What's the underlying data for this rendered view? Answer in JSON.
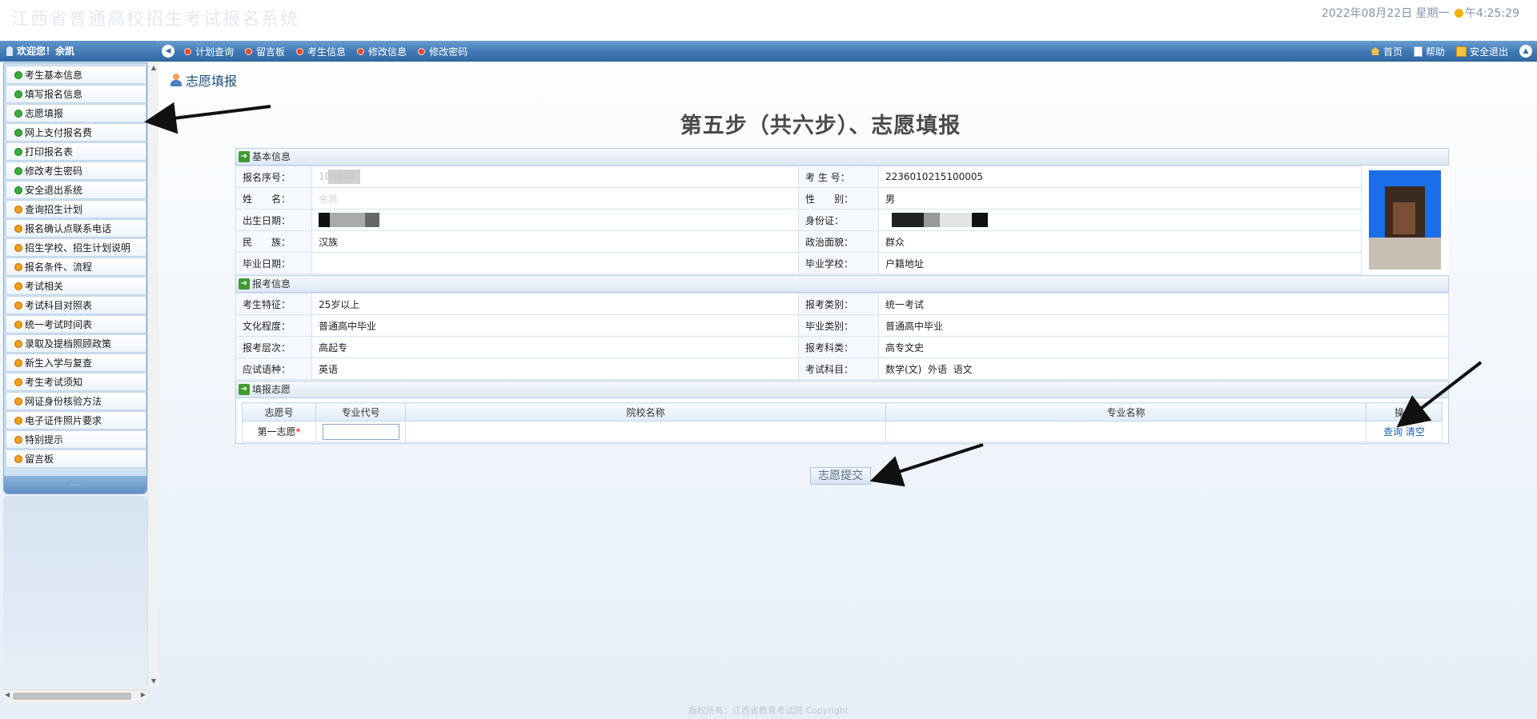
{
  "banner": {
    "title": "江西省普通高校招生考试报名系统",
    "datetime_prefix": "2022年08月22日 星期一",
    "time": "午4:25:29"
  },
  "navbar": {
    "welcome": "欢迎您！余凯",
    "items": [
      "计划查询",
      "留言板",
      "考生信息",
      "修改信息",
      "修改密码"
    ],
    "right": {
      "home": "首页",
      "help": "帮助",
      "logout": "安全退出"
    }
  },
  "sidebar": {
    "items": [
      {
        "label": "考生基本信息",
        "icon": "green"
      },
      {
        "label": "填写报名信息",
        "icon": "green"
      },
      {
        "label": "志愿填报",
        "icon": "green"
      },
      {
        "label": "网上支付报名费",
        "icon": "green"
      },
      {
        "label": "打印报名表",
        "icon": "green"
      },
      {
        "label": "修改考生密码",
        "icon": "green"
      },
      {
        "label": "安全退出系统",
        "icon": "green"
      },
      {
        "label": "查询招生计划",
        "icon": "orange"
      },
      {
        "label": "报名确认点联系电话",
        "icon": "orange"
      },
      {
        "label": "招生学校、招生计划说明",
        "icon": "orange"
      },
      {
        "label": "报名条件、流程",
        "icon": "orange"
      },
      {
        "label": "考试相关",
        "icon": "orange"
      },
      {
        "label": "考试科目对照表",
        "icon": "orange"
      },
      {
        "label": "统一考试时间表",
        "icon": "orange"
      },
      {
        "label": "录取及提档照顾政策",
        "icon": "orange"
      },
      {
        "label": "新生入学与复查",
        "icon": "orange"
      },
      {
        "label": "考生考试须知",
        "icon": "orange"
      },
      {
        "label": "网证身份核验方法",
        "icon": "orange"
      },
      {
        "label": "电子证件照片要求",
        "icon": "orange"
      },
      {
        "label": "特别提示",
        "icon": "orange"
      },
      {
        "label": "留言板",
        "icon": "orange"
      }
    ],
    "footer": "....."
  },
  "main": {
    "heading": "志愿填报",
    "step_title": "第五步（共六步）、志愿填报",
    "basic": {
      "title": "基本信息",
      "rows": [
        {
          "l1": "报名序号：",
          "v1": "100000",
          "l2": "考 生 号：",
          "v2": "2236010215100005"
        },
        {
          "l1": "姓　　名：",
          "v1": "余凯",
          "l2": "性　　别：",
          "v2": "男"
        },
        {
          "l1": "出生日期：",
          "v1": "",
          "l2": "身份证：",
          "v2": ""
        },
        {
          "l1": "民　　族：",
          "v1": "汉族",
          "l2": "政治面貌：",
          "v2": "群众"
        },
        {
          "l1": "毕业日期：",
          "v1": "",
          "l2": "毕业学校：",
          "v2": "户籍地址"
        }
      ]
    },
    "exam": {
      "title": "报考信息",
      "rows": [
        {
          "l1": "考生特征：",
          "v1": "25岁以上",
          "l2": "报考类别：",
          "v2": "统一考试"
        },
        {
          "l1": "文化程度：",
          "v1": "普通高中毕业",
          "l2": "毕业类别：",
          "v2": "普通高中毕业"
        },
        {
          "l1": "报考层次：",
          "v1": "高起专",
          "l2": "报考科类：",
          "v2": "高专文史"
        },
        {
          "l1": "应试语种：",
          "v1": "英语",
          "l2": "考试科目：",
          "v2": "数学(文)  外语  语文"
        }
      ]
    },
    "wish": {
      "title": "填报志愿",
      "headers": [
        "志愿号",
        "专业代号",
        "院校名称",
        "专业名称",
        "操作"
      ],
      "row": {
        "no": "第一志愿",
        "required": "*",
        "code": "",
        "school": "",
        "major": "",
        "query": "查询",
        "clear": "清空"
      }
    },
    "submit": "志愿提交"
  },
  "footer": "版权所有：江西省教育考试院 Copyright"
}
